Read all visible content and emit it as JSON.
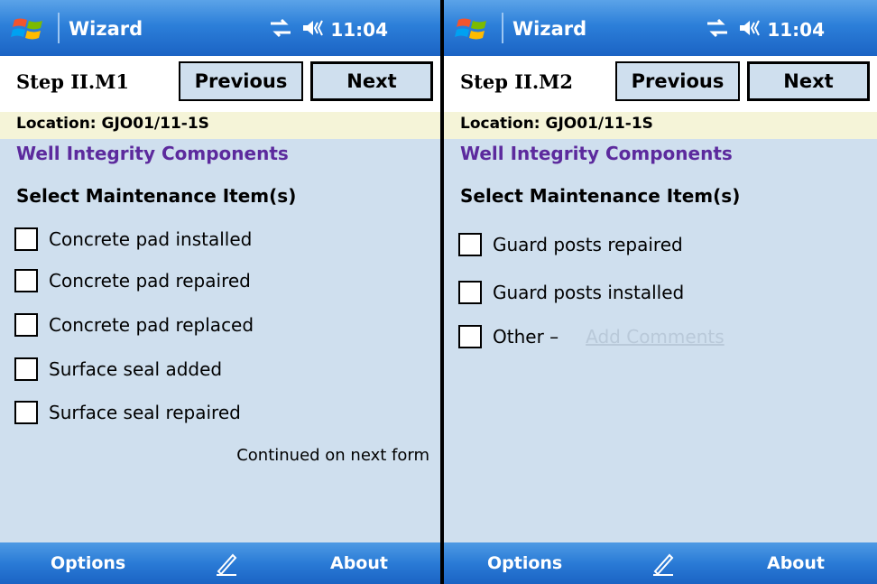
{
  "colors": {
    "titlebar": "#2c7fd9",
    "content_bg": "#cfdfee",
    "location_bg": "#f5f4d8",
    "section_title": "#5c2a9d",
    "disabled_link": "#b9c9d9"
  },
  "screens": [
    {
      "app_title": "Wizard",
      "time": "11:04",
      "step_label": "Step II.M1",
      "previous_label": "Previous",
      "next_label": "Next",
      "location": "Location: GJO01/11-1S",
      "section_title": "Well Integrity Components",
      "subheading": "Select Maintenance Item(s)",
      "items": [
        {
          "label": "Concrete pad installed",
          "checked": false
        },
        {
          "label": "Concrete pad repaired",
          "checked": false
        },
        {
          "label": "Concrete pad replaced",
          "checked": false
        },
        {
          "label": "Surface seal added",
          "checked": false
        },
        {
          "label": "Surface seal repaired",
          "checked": false
        }
      ],
      "note": "Continued on next form",
      "menu_left": "Options",
      "menu_right": "About",
      "icons": [
        "windows-start-icon",
        "connectivity-icon",
        "speaker-icon",
        "pen-input-icon"
      ]
    },
    {
      "app_title": "Wizard",
      "time": "11:04",
      "step_label": "Step II.M2",
      "previous_label": "Previous",
      "next_label": "Next",
      "location": "Location: GJO01/11-1S",
      "section_title": "Well Integrity Components",
      "subheading": "Select Maintenance Item(s)",
      "items": [
        {
          "label": "Guard posts repaired",
          "checked": false
        },
        {
          "label": "Guard posts installed",
          "checked": false
        },
        {
          "label": "Other –",
          "checked": false
        }
      ],
      "add_comments_label": "Add Comments",
      "menu_left": "Options",
      "menu_right": "About",
      "icons": [
        "windows-start-icon",
        "connectivity-icon",
        "speaker-icon",
        "pen-input-icon"
      ]
    }
  ]
}
